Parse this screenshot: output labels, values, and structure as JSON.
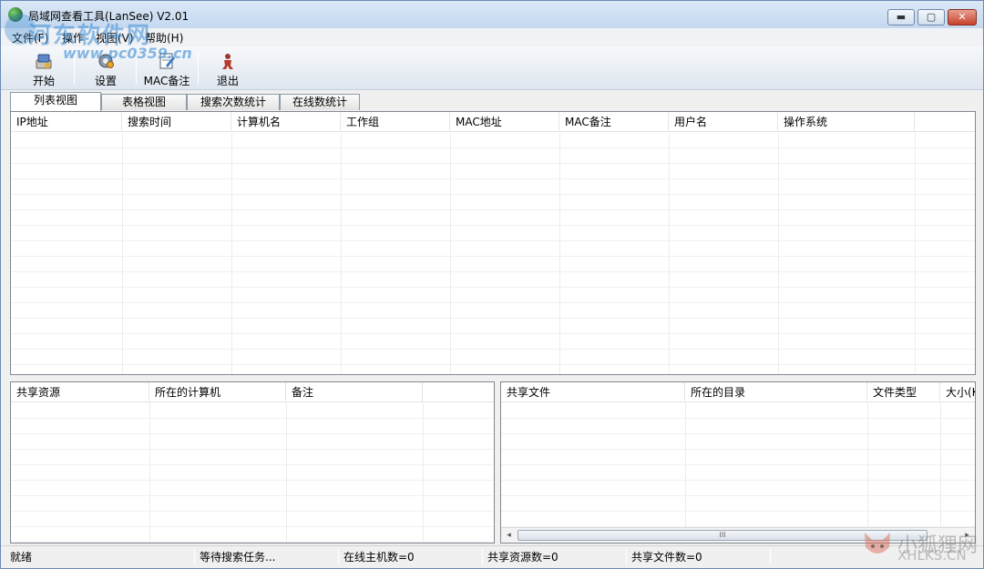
{
  "window": {
    "title": "局域网查看工具(LanSee) V2.01"
  },
  "window_controls": {
    "minimize": "▬",
    "maximize": "▢",
    "close": "✕"
  },
  "menu": [
    {
      "label": "文件(F)"
    },
    {
      "label": "操作"
    },
    {
      "label": "视图(V)"
    },
    {
      "label": "帮助(H)"
    }
  ],
  "toolbar": [
    {
      "label": "开始",
      "icon": "start-icon"
    },
    {
      "label": "设置",
      "icon": "settings-icon"
    },
    {
      "label": "MAC备注",
      "icon": "mac-note-icon"
    },
    {
      "label": "退出",
      "icon": "exit-icon"
    }
  ],
  "tabs": [
    {
      "label": "列表视图",
      "active": true
    },
    {
      "label": "表格视图",
      "active": false
    },
    {
      "label": "搜索次数统计",
      "active": false
    },
    {
      "label": "在线数统计",
      "active": false
    }
  ],
  "hosts_table": {
    "columns": [
      "IP地址",
      "搜索时间",
      "计算机名",
      "工作组",
      "MAC地址",
      "MAC备注",
      "用户名",
      "操作系统"
    ],
    "rows": []
  },
  "shares_table": {
    "columns": [
      "共享资源",
      "所在的计算机",
      "备注"
    ],
    "rows": []
  },
  "files_table": {
    "columns": [
      "共享文件",
      "所在的目录",
      "文件类型",
      "大小(K"
    ],
    "rows": [],
    "scrollbar": {
      "left_arrow": "◂",
      "right_arrow": "▸",
      "grip": "III"
    }
  },
  "status": {
    "state": "就绪",
    "task": "等待搜索任务...",
    "online_hosts": "在线主机数=0",
    "shared_resources": "共享资源数=0",
    "shared_files": "共享文件数=0"
  },
  "watermarks": {
    "site_name": "河东软件网",
    "site_url": "www.pc0359.cn",
    "brand_cn": "小狐狸网",
    "brand_en": "XHLKS.CN"
  }
}
